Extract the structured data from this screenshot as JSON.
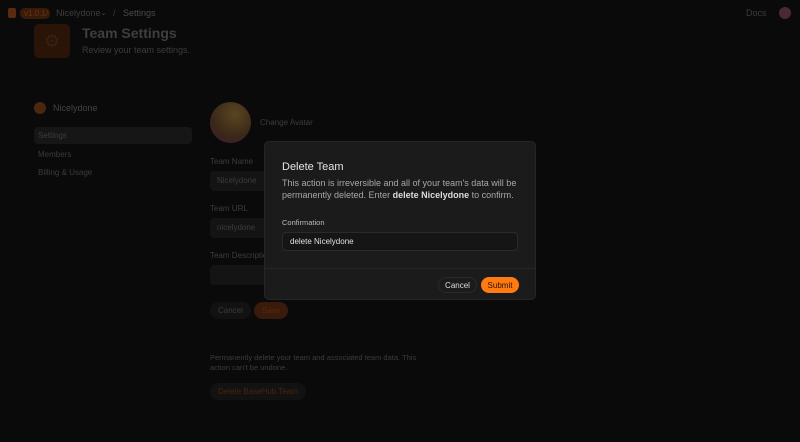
{
  "topbar": {
    "version": "v1.0.1",
    "team": "Nicelydone",
    "page": "Settings",
    "docs": "Docs"
  },
  "header": {
    "title": "Team Settings",
    "subtitle": "Review your team settings."
  },
  "sidebar": {
    "team": "Nicelydone",
    "items": [
      {
        "label": "Settings"
      },
      {
        "label": "Members"
      },
      {
        "label": "Billing & Usage"
      }
    ]
  },
  "form": {
    "change_avatar": "Change Avatar",
    "name_label": "Team Name",
    "name_value": "Nicelydone",
    "url_label": "Team URL",
    "url_value": "nicelydone",
    "desc_label": "Team Description",
    "cancel": "Cancel",
    "save": "Save",
    "danger_text": "Permanently delete your team and associated team data. This action can't be undone.",
    "delete_button": "Delete BaseHub Team"
  },
  "modal": {
    "title": "Delete Team",
    "desc_pre": "This action is irreversible and all of your team's data will be permanently deleted. Enter ",
    "desc_bold": "delete Nicelydone",
    "desc_post": " to confirm.",
    "confirm_label": "Confirmation",
    "confirm_value": "delete Nicelydone",
    "cancel": "Cancel",
    "submit": "Submit"
  }
}
